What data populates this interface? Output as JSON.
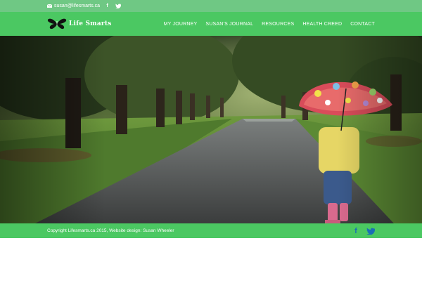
{
  "topbar": {
    "email": "susan@lifesmarts.ca",
    "icons": [
      "mail-icon",
      "facebook-icon",
      "twitter-icon"
    ]
  },
  "header": {
    "logo_text": "Life Smarts",
    "nav": [
      {
        "label": "MY JOURNEY"
      },
      {
        "label": "SUSAN'S JOURNAL"
      },
      {
        "label": "RESOURCES"
      },
      {
        "label": "HEALTH CREED"
      },
      {
        "label": "CONTACT"
      }
    ]
  },
  "footer": {
    "copyright": "Copyright Lifesmarts.ca 2015, Website design: Susan Wheeler",
    "icons": [
      "facebook-icon",
      "twitter-icon"
    ]
  },
  "colors": {
    "topbar": "#6fc884",
    "header": "#4bc862",
    "footer": "#4bc862",
    "social_icon": "#1a6fb5"
  }
}
